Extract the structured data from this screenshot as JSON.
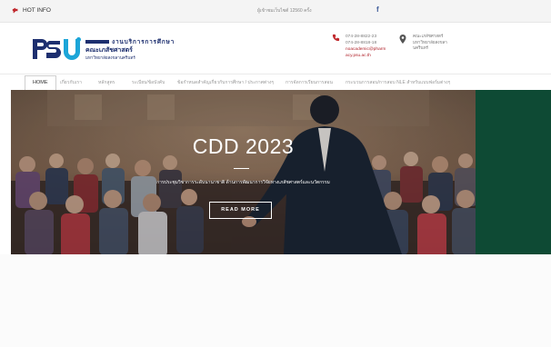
{
  "topbar": {
    "hot_label": "HOT INFO",
    "visitor_text": "ผู้เข้าชมเว็บไซต์ 12560 ครั้ง",
    "facebook_label": "f"
  },
  "header": {
    "logo_text": "PSU",
    "unit_name": "งานบริการการศึกษา",
    "faculty_name": "คณะเภสัชศาสตร์",
    "university_name": "มหาวิทยาลัยสงขลานครินทร์",
    "phone_1": "074-28-8822-23",
    "phone_2": "074-28-8818-18",
    "email_1": "noacademic@pharm",
    "email_2": "acy.psu.ac.th",
    "address_1": "คณะเภสัชศาสตร์",
    "address_2": "มหาวิทยาลัยสงขลา",
    "address_3": "นครินทร์"
  },
  "nav": {
    "items": [
      "HOME",
      "เกี่ยวกับเรา",
      "หลักสูตร",
      "ระเบียบ/ข้อบังคับ",
      "ข้อกำหนดสำคัญเกี่ยวกับการศึกษา / ประกาศต่างๆ",
      "การจัดการเรียนการสอน",
      "กระบวนการสอบ/การสอบ NLE สำหรับ",
      "แบบฟอร์มต่างๆ"
    ]
  },
  "hero": {
    "title": "CDD 2023",
    "subtitle": "การประชุมวิชาการระดับนานาชาติ ด้านการพัฒนาการวิจัยทางเภสัชศาสตร์และนวัตกรรม",
    "button_label": "READ MORE"
  },
  "colors": {
    "navy": "#1d2f6f",
    "accent_blue": "#1ca5d8",
    "email_red": "#b0222a",
    "side_green": "#0e4a34"
  }
}
